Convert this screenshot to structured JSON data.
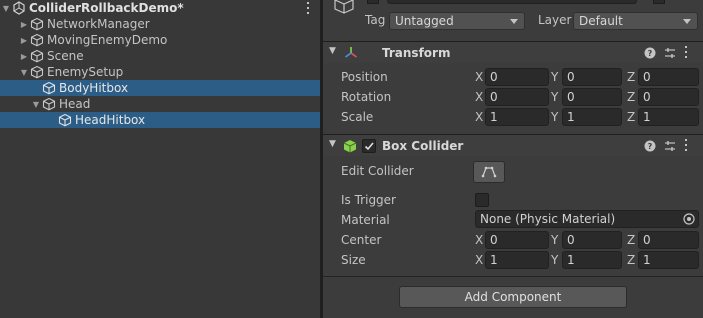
{
  "hierarchy": {
    "scene_name": "ColliderRollbackDemo*",
    "items": [
      {
        "label": "NetworkManager"
      },
      {
        "label": "MovingEnemyDemo"
      },
      {
        "label": "Scene"
      },
      {
        "label": "EnemySetup"
      },
      {
        "label": "BodyHitbox"
      },
      {
        "label": "Head"
      },
      {
        "label": "HeadHitbox"
      }
    ]
  },
  "inspector": {
    "header": {
      "tag_label": "Tag",
      "tag_value": "Untagged",
      "layer_label": "Layer",
      "layer_value": "Default"
    },
    "transform": {
      "title": "Transform",
      "rows": [
        {
          "label": "Position",
          "x": "0",
          "y": "0",
          "z": "0"
        },
        {
          "label": "Rotation",
          "x": "0",
          "y": "0",
          "z": "0"
        },
        {
          "label": "Scale",
          "x": "1",
          "y": "1",
          "z": "1"
        }
      ]
    },
    "box_collider": {
      "title": "Box Collider",
      "edit_collider_label": "Edit Collider",
      "is_trigger_label": "Is Trigger",
      "material_label": "Material",
      "material_value": "None (Physic Material)",
      "center": {
        "label": "Center",
        "x": "0",
        "y": "0",
        "z": "0"
      },
      "size": {
        "label": "Size",
        "x": "1",
        "y": "1",
        "z": "1"
      }
    },
    "add_component_label": "Add Component",
    "axis_labels": {
      "x": "X",
      "y": "Y",
      "z": "Z"
    }
  },
  "colors": {
    "selection": "#2c5d87",
    "panel_bg": "#383838",
    "inspector_bg": "#3c3c3c",
    "collider_icon": "#8ad14c"
  }
}
